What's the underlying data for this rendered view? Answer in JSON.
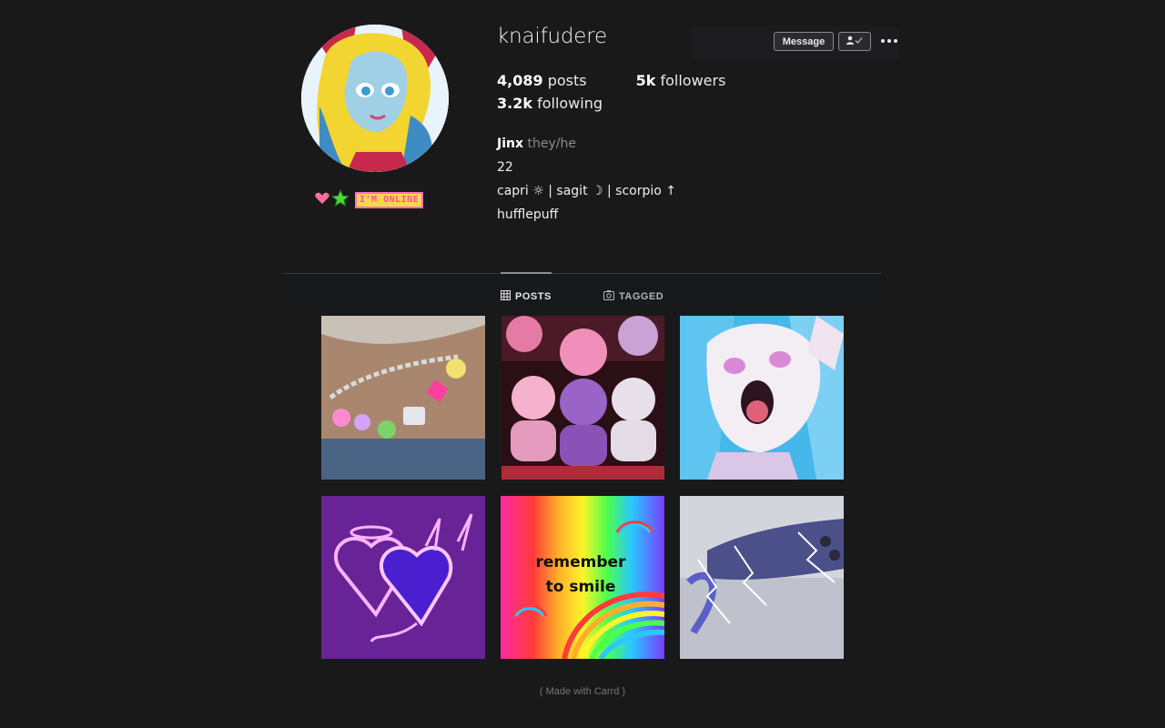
{
  "profile": {
    "username": "knaifudere",
    "online_badge": "I'M ONLINE"
  },
  "actions": {
    "message_label": "Message"
  },
  "stats": {
    "posts_count": "4,089",
    "posts_label": "posts",
    "followers_count": "5k",
    "followers_label": "followers",
    "following_count": "3.2k",
    "following_label": "following"
  },
  "bio": {
    "name": "Jinx",
    "pronouns": "they/he",
    "line1": "22",
    "line2": "capri ☼ | sagit ☽ | scorpio ↑",
    "line3": "hufflepuff"
  },
  "tabs": [
    {
      "label": "POSTS",
      "icon": "grid-icon",
      "active": true
    },
    {
      "label": "TAGGED",
      "icon": "tag-photo-icon",
      "active": false
    }
  ],
  "grid": {
    "tile_3_1_text_line1": "remember",
    "tile_3_1_text_line2": "to smile"
  },
  "footer": {
    "text": "( Made with Carrd )"
  },
  "colors": {
    "background": "#19191a",
    "divider": "#3a3a3c",
    "muted": "#8a8a8a"
  }
}
